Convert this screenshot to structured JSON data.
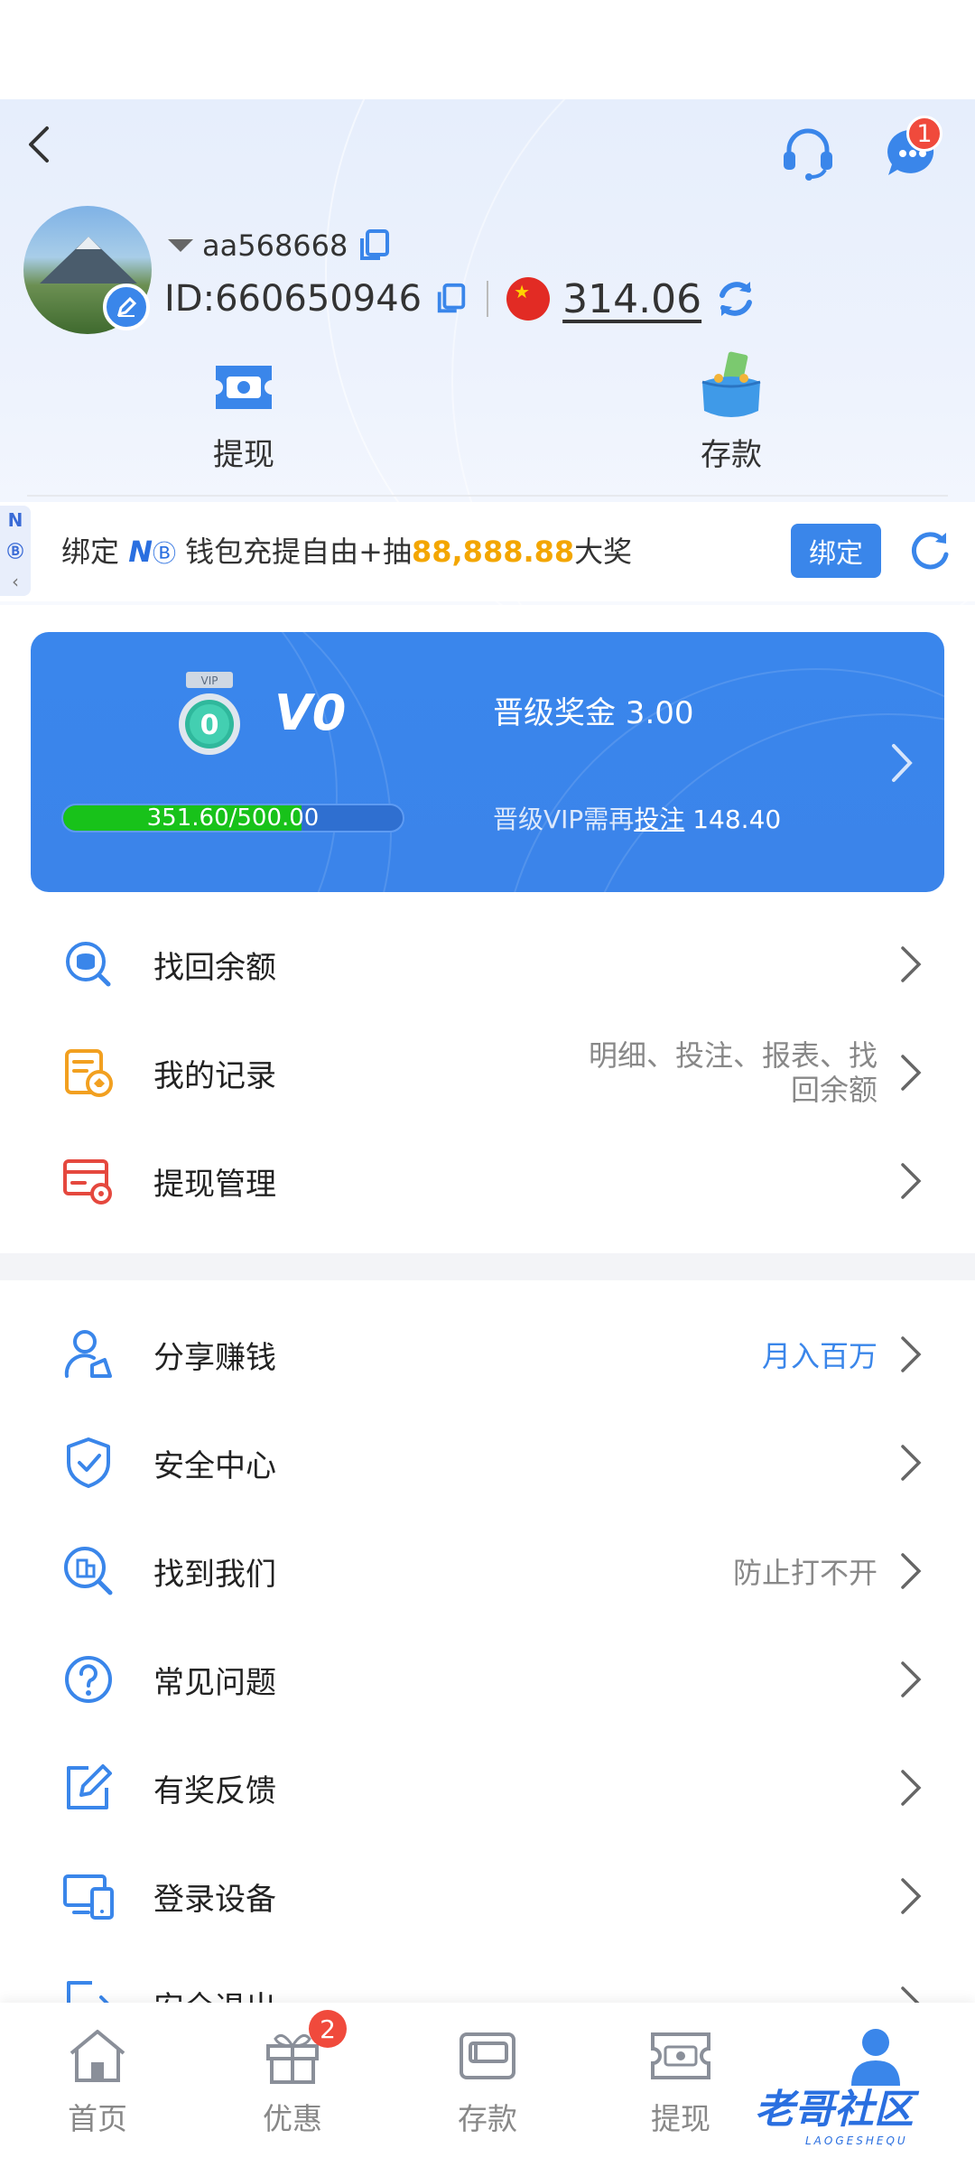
{
  "user": {
    "username": "aa568668",
    "id_label": "ID:660650946",
    "balance": "314.06"
  },
  "header": {
    "chat_badge": "1"
  },
  "quick_actions": [
    {
      "label": "提现",
      "icon": "withdraw-ticket-icon"
    },
    {
      "label": "存款",
      "icon": "purse-icon"
    }
  ],
  "promo": {
    "prefix": "绑定 ",
    "brand": "N",
    "middle": " 钱包充提自由+抽",
    "amount": "88,888.88",
    "suffix": "大奖",
    "bind_button": "绑定",
    "side_tab_letter": "N"
  },
  "vip": {
    "medal_level": "0",
    "level": "V0",
    "bonus": "晋级奖金 3.00",
    "progress_text": "351.60/500.00",
    "progress_fraction": 0.7032,
    "need_prefix": "晋级VIP需再",
    "need_link": "投注",
    "need_value": "148.40"
  },
  "menu_group1": [
    {
      "label": "找回余额",
      "right": "",
      "icon": "coin-search-icon"
    },
    {
      "label": "我的记录",
      "right_line1": "明细、投注、报表、找",
      "right_line2": "回余额",
      "icon": "record-icon"
    },
    {
      "label": "提现管理",
      "right": "",
      "icon": "withdraw-settings-icon"
    }
  ],
  "menu_group2": [
    {
      "label": "分享赚钱",
      "right": "月入百万",
      "icon": "share-user-icon"
    },
    {
      "label": "安全中心",
      "right": "",
      "icon": "shield-check-icon"
    },
    {
      "label": "找到我们",
      "right": "防止打不开",
      "icon": "building-search-icon"
    },
    {
      "label": "常见问题",
      "right": "",
      "icon": "question-icon"
    },
    {
      "label": "有奖反馈",
      "right": "",
      "icon": "feedback-edit-icon"
    },
    {
      "label": "登录设备",
      "right": "",
      "icon": "devices-icon"
    },
    {
      "label": "安全退出",
      "right": "",
      "icon": "logout-icon"
    }
  ],
  "bottom_nav": [
    {
      "label": "首页",
      "icon": "home-icon"
    },
    {
      "label": "优惠",
      "icon": "gift-icon",
      "badge": "2"
    },
    {
      "label": "存款",
      "icon": "wallet-icon"
    },
    {
      "label": "提现",
      "icon": "withdraw-icon"
    },
    {
      "label": "",
      "icon": "profile-icon",
      "active": true
    }
  ],
  "watermark": {
    "text": "老哥社区",
    "sub": "LAOGESHEQU"
  },
  "colors": {
    "accent": "#3a86ea",
    "badge": "#f04a3c",
    "promo_amount": "#f3a600",
    "progress_fill": "#18c21a"
  }
}
